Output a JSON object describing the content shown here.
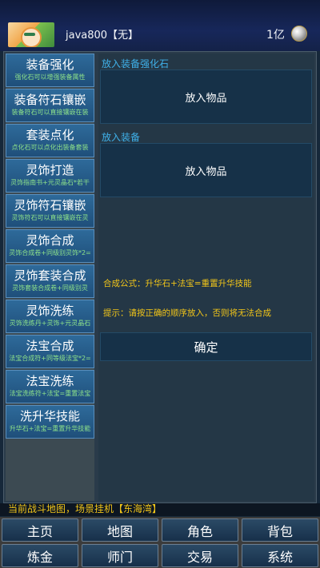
{
  "header": {
    "username": "java800【无】",
    "gold": "1亿",
    "avatar_icon": "character-avatar",
    "coin_icon": "silver-coin-icon"
  },
  "sidebar": {
    "items": [
      {
        "title": "装备强化",
        "desc": "强化石可以增强装备属性"
      },
      {
        "title": "装备符石镶嵌",
        "desc": "装备符石可以直接镶嵌在装"
      },
      {
        "title": "套装点化",
        "desc": "点化石可以点化出装备套装"
      },
      {
        "title": "灵饰打造",
        "desc": "灵饰指南书+元灵晶石*若干"
      },
      {
        "title": "灵饰符石镶嵌",
        "desc": "灵饰符石可以直接镶嵌在灵"
      },
      {
        "title": "灵饰合成",
        "desc": "灵饰合成卷+同级别灵饰*2="
      },
      {
        "title": "灵饰套装合成",
        "desc": "灵饰套装合成卷+同级别灵"
      },
      {
        "title": "灵饰洗练",
        "desc": "灵饰洗练丹+灵饰+元灵晶石"
      },
      {
        "title": "法宝合成",
        "desc": "法宝合成符+同等级法宝*2="
      },
      {
        "title": "法宝洗练",
        "desc": "法宝洗练符+法宝=重置法宝"
      },
      {
        "title": "洗升华技能",
        "desc": "升华石+法宝=重置升华技能"
      }
    ]
  },
  "content": {
    "section1_label": "放入装备强化石",
    "slot1_text": "放入物品",
    "section2_label": "放入装备",
    "slot2_text": "放入物品",
    "formula": "合成公式：升华石+法宝=重置升华技能",
    "tip": "提示：请按正确的顺序放入，否则将无法合成",
    "confirm_label": "确定"
  },
  "status_text": "当前战斗地图，场景挂机【东海湾】",
  "nav": {
    "row1": [
      "主页",
      "地图",
      "角色",
      "背包"
    ],
    "row2": [
      "炼金",
      "师门",
      "交易",
      "系统"
    ]
  }
}
